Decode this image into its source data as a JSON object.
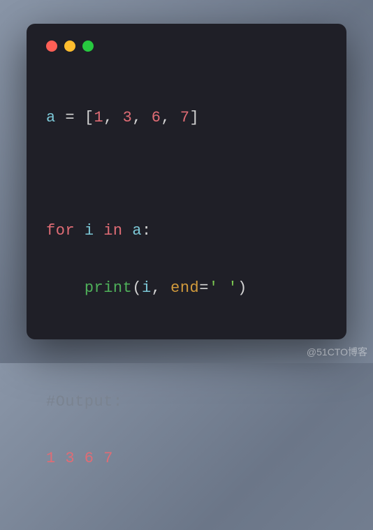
{
  "window": {
    "traffic_lights": [
      "red",
      "yellow",
      "green"
    ]
  },
  "code": {
    "line1": {
      "var_a": "a",
      "eq": " = ",
      "lbrack": "[",
      "n1": "1",
      "c1": ", ",
      "n2": "3",
      "c2": ", ",
      "n3": "6",
      "c3": ", ",
      "n4": "7",
      "rbrack": "]"
    },
    "line3": {
      "for": "for",
      "sp1": " ",
      "i": "i",
      "sp2": " ",
      "in": "in",
      "sp3": " ",
      "a": "a",
      "colon": ":"
    },
    "line4": {
      "indent": "    ",
      "print": "print",
      "lp": "(",
      "i": "i",
      "comma": ", ",
      "end": "end",
      "eq": "=",
      "str": "' '",
      "rp": ")"
    },
    "line6": {
      "comment": "#Output:"
    },
    "line7": {
      "output": "1 3 6 7"
    }
  },
  "watermark": "@51CTO博客"
}
